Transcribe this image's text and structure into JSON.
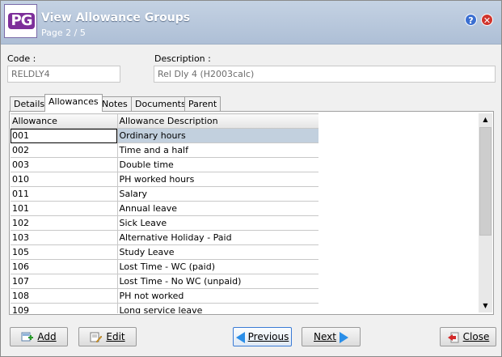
{
  "header": {
    "logo": "PG",
    "title": "View Allowance Groups",
    "subtitle": "Page 2 / 5",
    "help_icon": "?",
    "close_icon": "✕"
  },
  "fields": {
    "code_label": "Code :",
    "code_value": "RELDLY4",
    "description_label": "Description :",
    "description_value": "Rel Dly 4 (H2003calc)"
  },
  "tabs": [
    "Details",
    "Allowances",
    "Notes",
    "Documents",
    "Parent"
  ],
  "active_tab": "Allowances",
  "table": {
    "headers": [
      "Allowance",
      "Allowance Description"
    ],
    "rows": [
      [
        "001",
        "Ordinary hours"
      ],
      [
        "002",
        "Time and a half"
      ],
      [
        "003",
        "Double time"
      ],
      [
        "010",
        "PH worked hours"
      ],
      [
        "011",
        "Salary"
      ],
      [
        "101",
        "Annual leave"
      ],
      [
        "102",
        "Sick Leave"
      ],
      [
        "103",
        "Alternative Holiday - Paid"
      ],
      [
        "105",
        "Study Leave"
      ],
      [
        "106",
        "Lost Time - WC (paid)"
      ],
      [
        "107",
        "Lost Time - No WC (unpaid)"
      ],
      [
        "108",
        "PH not worked"
      ],
      [
        "109",
        "Long service leave"
      ]
    ]
  },
  "buttons": {
    "add": "Add",
    "edit": "Edit",
    "previous": "Previous",
    "next": "Next",
    "close": "Close"
  },
  "colors": {
    "header_bg": "#aebfd6",
    "selected_row": "#c2d0de",
    "logo_purple": "#7d2f9a",
    "nav_arrow": "#2a8ee8"
  }
}
